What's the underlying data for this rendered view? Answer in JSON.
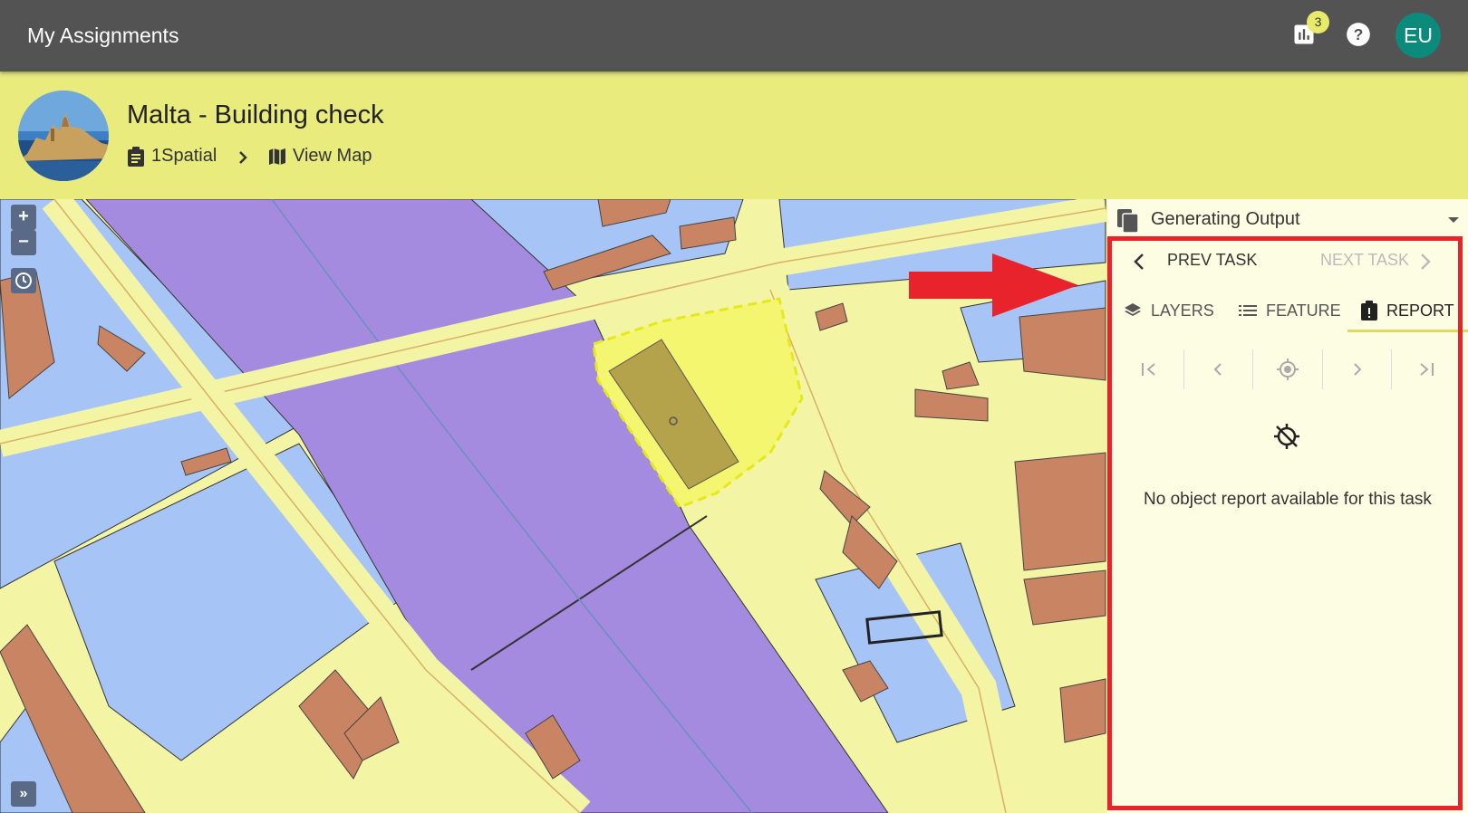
{
  "app": {
    "title": "My Assignments"
  },
  "topbar": {
    "stats_icon": "bar-chart-icon",
    "badge_count": "3",
    "help_icon": "help-circle-icon",
    "avatar_initials": "EU",
    "avatar_color": "#0c8a7c"
  },
  "project": {
    "title": "Malta - Building check",
    "breadcrumb": [
      {
        "label": "1Spatial",
        "icon": "clipboard-icon"
      },
      {
        "label": "View Map",
        "icon": "map-icon"
      }
    ],
    "header_color": "#e9eb7d"
  },
  "map_controls": {
    "zoom_in": "+",
    "zoom_out": "−",
    "expand": "»"
  },
  "panel": {
    "dropdown_label": "Generating Output",
    "prev_label": "PREV TASK",
    "next_label": "NEXT TASK",
    "tabs": [
      {
        "label": "LAYERS",
        "icon": "layers-icon"
      },
      {
        "label": "FEATURE",
        "icon": "list-icon"
      },
      {
        "label": "REPORT",
        "icon": "report-icon",
        "active": true
      }
    ],
    "empty_message": "No object report available for this task"
  },
  "colors": {
    "highlight": "#e8232b",
    "topbar": "#535353",
    "map_purple": "#a48bdf",
    "map_yellow": "#f3f4a4",
    "map_blue": "#a7c4f6",
    "map_building": "#c98563",
    "selected_feature": "#f3f66e"
  }
}
